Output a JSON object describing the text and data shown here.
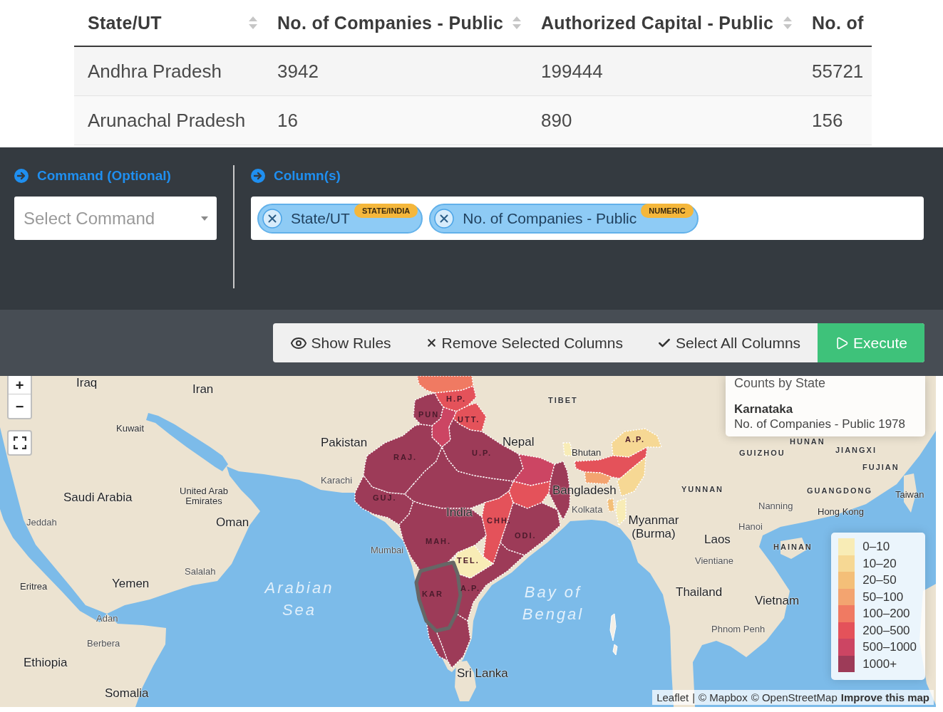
{
  "table": {
    "columns": [
      {
        "label": "State/UT",
        "sortable": true
      },
      {
        "label": "No. of Companies - Public",
        "sortable": true
      },
      {
        "label": "Authorized Capital - Public",
        "sortable": true
      },
      {
        "label": "No. of",
        "sortable": false
      }
    ],
    "rows": [
      [
        "Andhra Pradesh",
        "3942",
        "199444",
        "55721"
      ],
      [
        "Arunachal Pradesh",
        "16",
        "890",
        "156"
      ]
    ]
  },
  "command": {
    "title": "Command (Optional)",
    "placeholder": "Select Command"
  },
  "columns_picker": {
    "title": "Column(s)",
    "chips": [
      {
        "label": "State/UT",
        "badge": "STATE/INDIA"
      },
      {
        "label": "No. of Companies - Public",
        "badge": "NUMERIC"
      }
    ]
  },
  "actions": [
    {
      "label": "Show Rules",
      "kind": "rules"
    },
    {
      "label": "Remove Selected Columns",
      "kind": "remove"
    },
    {
      "label": "Select All Columns",
      "kind": "select_all"
    },
    {
      "label": "Execute",
      "kind": "execute"
    }
  ],
  "map": {
    "zoom_in": "+",
    "zoom_out": "−",
    "places": [
      {
        "name": "Iraq",
        "kind": "country"
      },
      {
        "name": "Iran",
        "kind": "country"
      },
      {
        "name": "TIBET",
        "kind": "province"
      },
      {
        "name": "Kuwait",
        "kind": "minor"
      },
      {
        "name": "Pakistan",
        "kind": "country"
      },
      {
        "name": "Nepal",
        "kind": "country"
      },
      {
        "name": "HUNAN",
        "kind": "province"
      },
      {
        "name": "Bhutan",
        "kind": "minor"
      },
      {
        "name": "GUIZHOU",
        "kind": "province"
      },
      {
        "name": "JIANGXI",
        "kind": "province"
      },
      {
        "name": "FUJIAN",
        "kind": "province"
      },
      {
        "name": "Karachi",
        "kind": "city"
      },
      {
        "name": "Saudi Arabia",
        "kind": "country"
      },
      {
        "name": "United Arab Emirates",
        "kind": "minor"
      },
      {
        "name": "Bangladesh",
        "kind": "country"
      },
      {
        "name": "YUNNAN",
        "kind": "province"
      },
      {
        "name": "GUANGDONG",
        "kind": "province"
      },
      {
        "name": "Taiwan",
        "kind": "minor"
      },
      {
        "name": "India",
        "kind": "country"
      },
      {
        "name": "Kolkata",
        "kind": "city"
      },
      {
        "name": "Nanning",
        "kind": "city"
      },
      {
        "name": "Hong Kong",
        "kind": "minor"
      },
      {
        "name": "Jeddah",
        "kind": "city"
      },
      {
        "name": "Oman",
        "kind": "country"
      },
      {
        "name": "Myanmar (Burma)",
        "kind": "country"
      },
      {
        "name": "Hanoi",
        "kind": "city"
      },
      {
        "name": "Laos",
        "kind": "country"
      },
      {
        "name": "Mumbai",
        "kind": "city"
      },
      {
        "name": "HAINAN",
        "kind": "province"
      },
      {
        "name": "Vientiane",
        "kind": "city"
      },
      {
        "name": "Salalah",
        "kind": "city"
      },
      {
        "name": "Eritrea",
        "kind": "minor"
      },
      {
        "name": "Yemen",
        "kind": "country"
      },
      {
        "name": "Arabian Sea",
        "kind": "sea"
      },
      {
        "name": "Bay of Bengal",
        "kind": "sea"
      },
      {
        "name": "Thailand",
        "kind": "country"
      },
      {
        "name": "Vietnam",
        "kind": "country"
      },
      {
        "name": "Adan",
        "kind": "city"
      },
      {
        "name": "Phnom Penh",
        "kind": "city"
      },
      {
        "name": "Berbera",
        "kind": "city"
      },
      {
        "name": "Ethiopia",
        "kind": "country"
      },
      {
        "name": "Sri Lanka",
        "kind": "country"
      },
      {
        "name": "Somalia",
        "kind": "country"
      }
    ],
    "regions": [
      {
        "color": "#f07a62",
        "highlighted": false
      },
      {
        "label": "H.P.",
        "color": "#e4525a",
        "highlighted": false
      },
      {
        "label": "PUN.",
        "color": "#9d3b58",
        "highlighted": false
      },
      {
        "label": "UTT.",
        "color": "#e4525a",
        "highlighted": false
      },
      {
        "color": "#cc4563",
        "highlighted": false
      },
      {
        "color": "#f8ecb6",
        "highlighted": false
      },
      {
        "label": "A.P.",
        "color": "#f6d894",
        "highlighted": false
      },
      {
        "label": "RAJ.",
        "color": "#9d3b58",
        "highlighted": false
      },
      {
        "label": "U.P.",
        "color": "#9d3b58",
        "highlighted": false
      },
      {
        "color": "#cc4563",
        "highlighted": false
      },
      {
        "color": "#e4525a",
        "highlighted": false
      },
      {
        "color": "#f3a470",
        "highlighted": false
      },
      {
        "color": "#f6d894",
        "highlighted": false
      },
      {
        "color": "#9d3b58",
        "highlighted": false
      },
      {
        "label": "GUJ.",
        "color": "#9d3b58",
        "highlighted": false
      },
      {
        "color": "#e4525a",
        "highlighted": false
      },
      {
        "color": "#f4bf78",
        "highlighted": false
      },
      {
        "color": "#f8ecb6",
        "highlighted": false
      },
      {
        "color": "#9d3b58",
        "highlighted": false
      },
      {
        "label": "CHH.",
        "color": "#e4525a",
        "highlighted": false
      },
      {
        "label": "MAH.",
        "color": "#9d3b58",
        "highlighted": false
      },
      {
        "label": "ODI.",
        "color": "#9d3b58",
        "highlighted": false
      },
      {
        "label": "TEL.",
        "color": "#f8ecb6",
        "highlighted": false
      },
      {
        "label": "KAR",
        "color": "#9d3b58",
        "highlighted": true
      },
      {
        "label": "A.P.",
        "color": "#9d3b58",
        "highlighted": false
      },
      {
        "color": "#9d3b58",
        "highlighted": false
      },
      {
        "color": "#9d3b58",
        "highlighted": false
      }
    ],
    "info": {
      "title": "Counts by State",
      "state": "Karnataka",
      "detail": "No. of Companies - Public 1978"
    },
    "legend": [
      {
        "range": "0–10",
        "color": "#f8ecb6"
      },
      {
        "range": "10–20",
        "color": "#f6d894"
      },
      {
        "range": "20–50",
        "color": "#f4bf78"
      },
      {
        "range": "50–100",
        "color": "#f3a470"
      },
      {
        "range": "100–200",
        "color": "#f07a62"
      },
      {
        "range": "200–500",
        "color": "#e4525a"
      },
      {
        "range": "500–1000",
        "color": "#cc4563"
      },
      {
        "range": "1000+",
        "color": "#9d3b58"
      }
    ],
    "attribution": {
      "prefix": "Leaflet",
      "separator": "|",
      "links": [
        {
          "text": "© Mapbox",
          "bold": false
        },
        {
          "text": "© OpenStreetMap",
          "bold": false
        },
        {
          "text": "Improve this map",
          "bold": true
        }
      ]
    }
  }
}
